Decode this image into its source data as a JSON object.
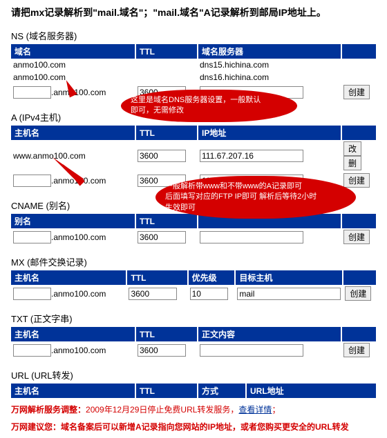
{
  "instruction": "请把mx记录解析到\"mail.域名\"；\"mail.域名\"A记录解析到邮局IP地址上。",
  "ns": {
    "title": "NS (域名服务器)",
    "headers": {
      "domain": "域名",
      "ttl": "TTL",
      "server": "域名服务器"
    },
    "rows": [
      {
        "domain": "anmo100.com",
        "server": "dns15.hichina.com"
      },
      {
        "domain": "anmo100.com",
        "server": "dns16.hichina.com"
      }
    ],
    "input": {
      "suffix": ".anmo100.com",
      "ttl": "3600"
    }
  },
  "a": {
    "title": "A (IPv4主机)",
    "headers": {
      "host": "主机名",
      "ttl": "TTL",
      "ip": "IP地址"
    },
    "rows": [
      {
        "host": "www.anmo100.com",
        "ttl": "3600",
        "ip": "111.67.207.16"
      }
    ],
    "input": {
      "suffix": ".anmo100.com",
      "ttl": "3600",
      "ip": "111.67.207.16"
    }
  },
  "cname": {
    "title": "CNAME (别名)",
    "headers": {
      "alias": "别名",
      "ttl": "TTL"
    },
    "input": {
      "suffix": ".anmo100.com",
      "ttl": "3600"
    }
  },
  "mx": {
    "title": "MX (邮件交换记录)",
    "headers": {
      "host": "主机名",
      "ttl": "TTL",
      "pri": "优先级",
      "target": "目标主机"
    },
    "input": {
      "suffix": ".anmo100.com",
      "ttl": "3600",
      "pri": "10",
      "target": "mail"
    }
  },
  "txt": {
    "title": "TXT (正文字串)",
    "headers": {
      "host": "主机名",
      "ttl": "TTL",
      "content": "正文内容"
    },
    "input": {
      "suffix": ".anmo100.com",
      "ttl": "3600"
    }
  },
  "url": {
    "title": "URL (URL转发)",
    "headers": {
      "host": "主机名",
      "ttl": "TTL",
      "method": "方式",
      "url": "URL地址"
    }
  },
  "buttons": {
    "create": "创建",
    "modify": "改",
    "delete": "删"
  },
  "callouts": {
    "c1_l1": "这里是域名DNS服务器设置，一般默认",
    "c1_l2": "即可，无需修改",
    "c2_l1": "一般解析带www和不带www的A记录即可",
    "c2_l2": "后面填写对应的FTP IP即可 解析后等待2小时",
    "c2_l3": "生效即可"
  },
  "footer": {
    "warning1a": "万网解析服务调整：",
    "warning1b": "2009年12月29日停止免费URL转发服务，",
    "link1": "查看详情",
    "semicolon": "；",
    "warning2": "万网建议您：域名备案后可以新增A记录指向您网站的IP地址，或者您购买更安全的URL转发"
  }
}
